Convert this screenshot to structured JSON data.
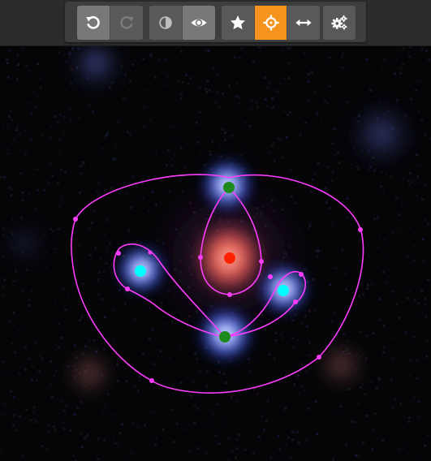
{
  "toolbar": {
    "groups": [
      {
        "name": "history",
        "buttons": [
          {
            "id": "undo",
            "icon": "undo-icon",
            "state": "pressed"
          },
          {
            "id": "redo",
            "icon": "redo-icon",
            "state": "disabled"
          }
        ]
      },
      {
        "name": "view",
        "buttons": [
          {
            "id": "contrast",
            "icon": "contrast-icon",
            "state": "normal"
          },
          {
            "id": "show",
            "icon": "eye-icon",
            "state": "pressed"
          }
        ]
      },
      {
        "name": "tools",
        "buttons": [
          {
            "id": "star",
            "icon": "star-icon",
            "state": "normal"
          },
          {
            "id": "crosshair",
            "icon": "crosshair-icon",
            "state": "active"
          },
          {
            "id": "measure",
            "icon": "double-arrow-icon",
            "state": "normal"
          }
        ]
      },
      {
        "name": "settings",
        "buttons": [
          {
            "id": "settings",
            "icon": "gears-icon",
            "state": "normal"
          }
        ]
      }
    ]
  },
  "colors": {
    "toolbar_bg": "#3e3e3e",
    "button_bg": "#595959",
    "button_pressed": "#787878",
    "active_accent": "#f7941d",
    "sky_bg": "#050508",
    "critical_curve": "#ff3cff",
    "lens_center": "#ff2200",
    "image_saddle": "#1d8a1d",
    "image_extremum": "#00ffff"
  },
  "lens_model": {
    "markers": [
      {
        "type": "lens-center",
        "color": "#ff2200"
      },
      {
        "type": "saddle-image",
        "color": "#1d8a1d"
      },
      {
        "type": "saddle-image",
        "color": "#1d8a1d"
      },
      {
        "type": "extremum-image",
        "color": "#00ffff"
      },
      {
        "type": "extremum-image",
        "color": "#00ffff"
      }
    ],
    "curve_color": "#ff3cff"
  }
}
